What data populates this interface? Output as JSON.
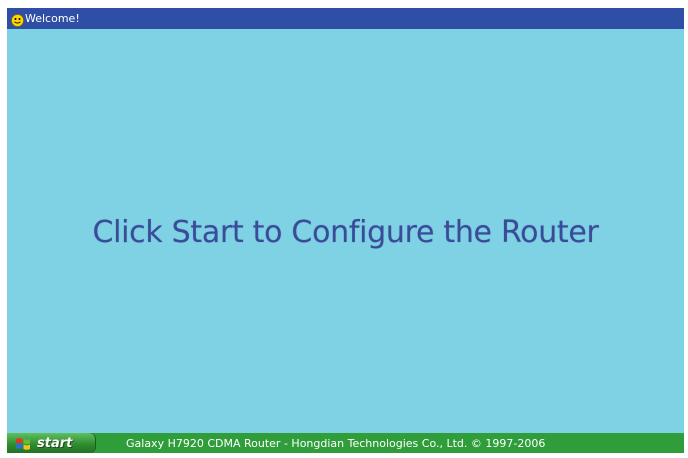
{
  "window": {
    "title": "Welcome!",
    "title_icon": "smiley-icon"
  },
  "main": {
    "headline": "Click Start to Configure the Router"
  },
  "taskbar": {
    "start_label": "start",
    "start_icon": "windows-flag-icon",
    "footer_text": "Galaxy H7920 CDMA Router - Hongdian Technologies Co., Ltd. © 1997-2006"
  },
  "colors": {
    "titlebar": "#2f4ea5",
    "background": "#7ed2e3",
    "headline": "#3a4b9a",
    "taskbar": "#2f9e3a"
  }
}
